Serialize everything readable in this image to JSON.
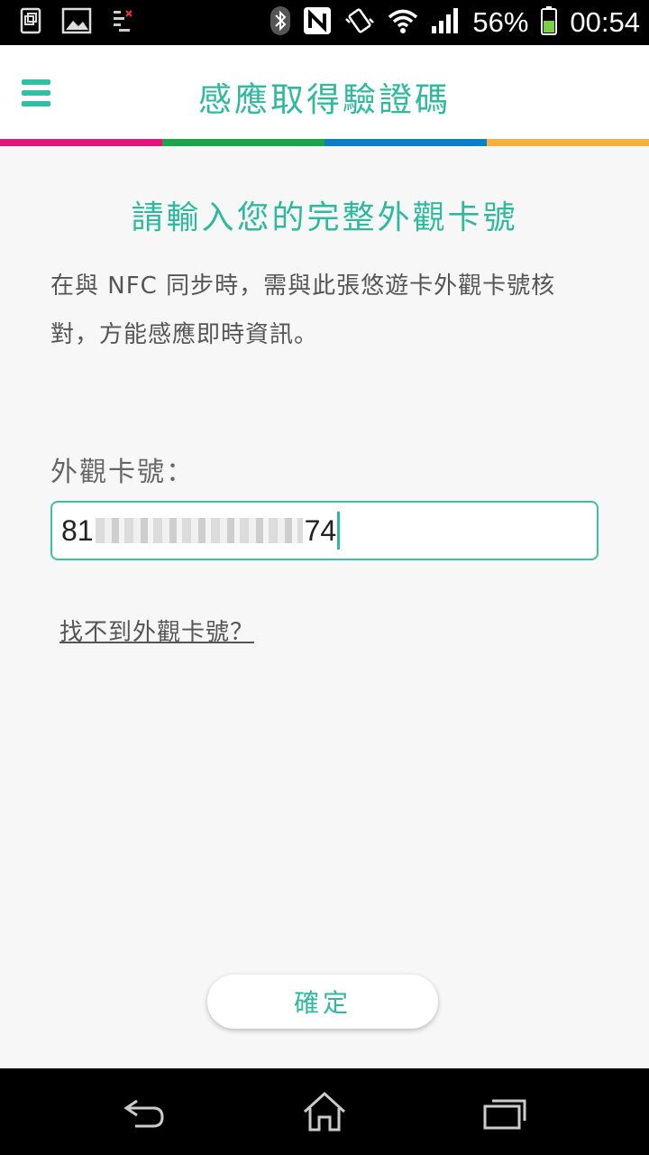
{
  "status_bar": {
    "battery_percent": "56%",
    "time": "00:54",
    "icons": [
      "screenshot-icon",
      "gallery-icon",
      "sim-icon",
      "bluetooth-icon",
      "nfc-icon",
      "vibrate-icon",
      "wifi-icon",
      "signal-icon",
      "battery-icon"
    ]
  },
  "app_bar": {
    "title": "感應取得驗證碼",
    "menu_icon": "hamburger-menu-icon"
  },
  "color_strip": [
    "#e6127f",
    "#1aa54c",
    "#0b7fc6",
    "#f6b042"
  ],
  "content": {
    "heading": "請輸入您的完整外觀卡號",
    "description": "在與 NFC 同步時，需與此張悠遊卡外觀卡號核對，方能感應即時資訊。",
    "field_label": "外觀卡號：",
    "card_number_prefix": "81",
    "card_number_suffix": "74",
    "help_link": "找不到外觀卡號？",
    "confirm_button": "確定"
  },
  "nav_bar": {
    "icons": [
      "back-icon",
      "home-icon",
      "recents-icon"
    ]
  },
  "colors": {
    "accent": "#2fb99e",
    "text_secondary": "#555555",
    "background": "#f7f7f7"
  }
}
